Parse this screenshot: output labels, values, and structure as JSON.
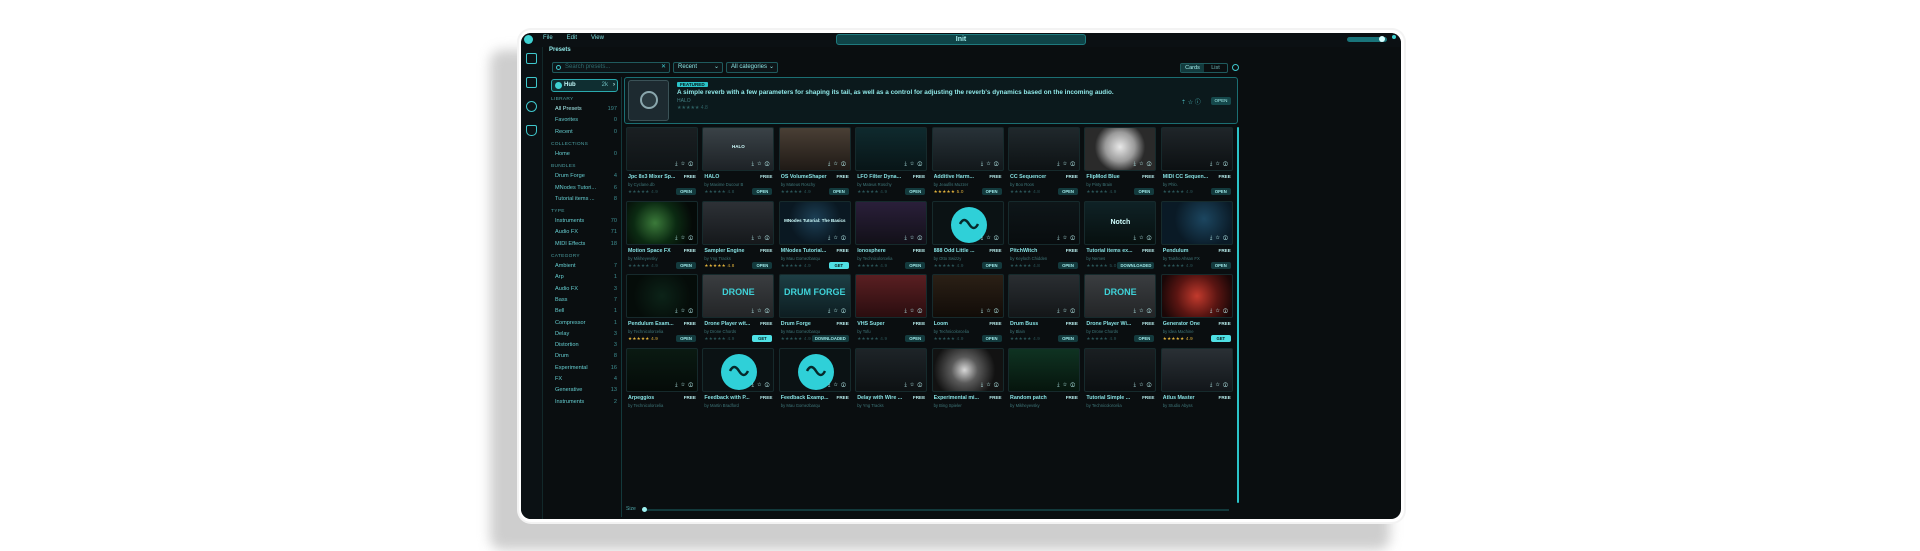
{
  "app": {
    "title": "Init",
    "menu": [
      "File",
      "Edit",
      "View"
    ]
  },
  "header": {
    "section_title": "Presets",
    "search_placeholder": "Search presets...",
    "sort_value": "Recent",
    "category_value": "All categories",
    "view_card": "Cards",
    "view_list": "List"
  },
  "sidebar": {
    "hub_label": "Hub",
    "hub_count": "2k",
    "sections": [
      {
        "title": "LIBRARY",
        "items": [
          {
            "label": "All Presets",
            "count": "197"
          },
          {
            "label": "Favorites",
            "count": "0"
          },
          {
            "label": "Recent",
            "count": "0"
          }
        ]
      },
      {
        "title": "COLLECTIONS",
        "items": [
          {
            "label": "Home",
            "count": "0"
          }
        ]
      },
      {
        "title": "BUNDLES",
        "items": [
          {
            "label": "Drum Forge",
            "count": "4"
          },
          {
            "label": "MNodes Tutori...",
            "count": "6"
          },
          {
            "label": "Tutorial items ...",
            "count": "8"
          }
        ]
      },
      {
        "title": "TYPE",
        "items": [
          {
            "label": "Instruments",
            "count": "70"
          },
          {
            "label": "Audio FX",
            "count": "71"
          },
          {
            "label": "MIDI Effects",
            "count": "18"
          }
        ]
      },
      {
        "title": "CATEGORY",
        "items": [
          {
            "label": "Ambient",
            "count": "7"
          },
          {
            "label": "Arp",
            "count": "1"
          },
          {
            "label": "Audio FX",
            "count": "3"
          },
          {
            "label": "Bass",
            "count": "7"
          },
          {
            "label": "Bell",
            "count": "1"
          },
          {
            "label": "Compressor",
            "count": "1"
          },
          {
            "label": "Delay",
            "count": "3"
          },
          {
            "label": "Distortion",
            "count": "3"
          },
          {
            "label": "Drum",
            "count": "8"
          },
          {
            "label": "Experimental",
            "count": "16"
          },
          {
            "label": "FX",
            "count": "4"
          },
          {
            "label": "Generative",
            "count": "13"
          },
          {
            "label": "Instruments",
            "count": "2"
          }
        ]
      }
    ]
  },
  "featured": {
    "tag": "FEATURED",
    "description": "A simple reverb with a few parameters for shaping its tail, as well as a control for adjusting the reverb's dynamics based on the incoming audio.",
    "name": "HALO",
    "rating": "★★★★★ 4.8",
    "open_label": "OPEN",
    "actions": "⇡ ☆ ⓘ"
  },
  "cards": [
    {
      "title": "Jpc 8x3 Mixer Sp...",
      "free": "FREE",
      "author": "by Cyclane.db",
      "stars": "★★★★★ 4.9",
      "button": "OPEN",
      "thumb_text": ""
    },
    {
      "title": "HALO",
      "free": "FREE",
      "author": "by Maxime Ducour B",
      "stars": "★★★★★ 4.8",
      "button": "OPEN",
      "thumb_text": "HALO"
    },
    {
      "title": "OS VolumeShaper",
      "free": "FREE",
      "author": "by Mateus Roschy",
      "stars": "★★★★★ 4.9",
      "button": "OPEN",
      "thumb_text": ""
    },
    {
      "title": "LFO Filter Dyna...",
      "free": "FREE",
      "author": "by Mateus Roschy",
      "stars": "★★★★★ 4.9",
      "button": "OPEN",
      "thumb_text": ""
    },
    {
      "title": "Additive Harm...",
      "free": "FREE",
      "author": "by Jeaufils Muzzer",
      "stars": "★★★★★ 5.0",
      "button": "OPEN",
      "thumb_text": "",
      "gold": true
    },
    {
      "title": "CC Sequencer",
      "free": "FREE",
      "author": "by Boo Roos",
      "stars": "★★★★★ 4.8",
      "button": "OPEN",
      "thumb_text": ""
    },
    {
      "title": "FlipMod Blue",
      "free": "FREE",
      "author": "by Pinty Brain",
      "stars": "★★★★★ 4.9",
      "button": "OPEN",
      "thumb_text": ""
    },
    {
      "title": "MIDI CC Sequen...",
      "free": "FREE",
      "author": "by Phlo.",
      "stars": "★★★★★ 4.9",
      "button": "OPEN",
      "thumb_text": ""
    },
    {
      "title": "Motion Space FX",
      "free": "FREE",
      "author": "by Mikheyevsky",
      "stars": "★★★★★ 4.9",
      "button": "OPEN",
      "thumb_text": ""
    },
    {
      "title": "Sampler Engine",
      "free": "FREE",
      "author": "by Yng Tracks",
      "stars": "★★★★★ 4.8",
      "button": "OPEN",
      "thumb_text": "",
      "gold": true
    },
    {
      "title": "MNodes Tutorial...",
      "free": "FREE",
      "author": "by Mau Gomezbarqu",
      "stars": "★★★★★ 4.9",
      "button": "GET",
      "thumb_text": "MNodes Tutorial: The Basics"
    },
    {
      "title": "Ionosphere",
      "free": "FREE",
      "author": "by Technicolorcelia",
      "stars": "★★★★★ 4.9",
      "button": "OPEN",
      "thumb_text": ""
    },
    {
      "title": "888 Odd Little ...",
      "free": "FREE",
      "author": "by Otto Swizzy",
      "stars": "★★★★★ 4.9",
      "button": "OPEN",
      "thumb_text": ""
    },
    {
      "title": "PitchWitch",
      "free": "FREE",
      "author": "by Keyloch Chidden",
      "stars": "★★★★★ 4.8",
      "button": "OPEN",
      "thumb_text": ""
    },
    {
      "title": "Tutorial items ex...",
      "free": "FREE",
      "author": "by Nemes",
      "stars": "★★★★★ 5.0",
      "button": "DOWNLOADED",
      "thumb_text": "Notch"
    },
    {
      "title": "Pendulum",
      "free": "FREE",
      "author": "by Taisho Ahsan FX",
      "stars": "★★★★★ 4.9",
      "button": "OPEN",
      "thumb_text": ""
    },
    {
      "title": "Pendulum Exam...",
      "free": "FREE",
      "author": "by Technicolorcelia",
      "stars": "★★★★★ 4.9",
      "button": "OPEN",
      "thumb_text": "",
      "gold": true
    },
    {
      "title": "Drone Player wit...",
      "free": "FREE",
      "author": "by Drone Chords",
      "stars": "★★★★★ 4.9",
      "button": "GET",
      "thumb_text": "DRONE"
    },
    {
      "title": "Drum Forge",
      "free": "FREE",
      "author": "by Mau Gomezbarqu",
      "stars": "★★★★★ 4.9",
      "button": "DOWNLOADED",
      "thumb_text": "DRUM FORGE"
    },
    {
      "title": "VHS Super",
      "free": "FREE",
      "author": "by Tofu",
      "stars": "★★★★★ 4.9",
      "button": "OPEN",
      "thumb_text": ""
    },
    {
      "title": "Loom",
      "free": "FREE",
      "author": "by Technicolorcelia",
      "stars": "★★★★★ 4.9",
      "button": "OPEN",
      "thumb_text": ""
    },
    {
      "title": "Drum Buss",
      "free": "FREE",
      "author": "by Blain",
      "stars": "★★★★★ 4.9",
      "button": "OPEN",
      "thumb_text": ""
    },
    {
      "title": "Drone Player Wi...",
      "free": "FREE",
      "author": "by Drone Chords",
      "stars": "★★★★★ 4.9",
      "button": "OPEN",
      "thumb_text": "DRONE"
    },
    {
      "title": "Generator One",
      "free": "FREE",
      "author": "by Idea Machine",
      "stars": "★★★★★ 4.9",
      "button": "GET",
      "thumb_text": "",
      "gold": true
    },
    {
      "title": "Arpeggios",
      "free": "FREE",
      "author": "by Technicolorcelia",
      "stars": "",
      "button": "",
      "thumb_text": ""
    },
    {
      "title": "Feedback with P...",
      "free": "FREE",
      "author": "by Martin Bradford",
      "stars": "",
      "button": "",
      "thumb_text": ""
    },
    {
      "title": "Feedback Examp...",
      "free": "FREE",
      "author": "by Mau Gomezbarqu",
      "stars": "",
      "button": "",
      "thumb_text": ""
    },
    {
      "title": "Delay with Wire ...",
      "free": "FREE",
      "author": "by Yng Tracks",
      "stars": "",
      "button": "",
      "thumb_text": ""
    },
    {
      "title": "Experimental mi...",
      "free": "FREE",
      "author": "by Bing Spieler",
      "stars": "",
      "button": "",
      "thumb_text": ""
    },
    {
      "title": "Random patch",
      "free": "FREE",
      "author": "by Mikheyevsky",
      "stars": "",
      "button": "",
      "thumb_text": ""
    },
    {
      "title": "Tutorial Simple ...",
      "free": "FREE",
      "author": "by Technicolorcelia",
      "stars": "",
      "button": "",
      "thumb_text": ""
    },
    {
      "title": "Atlus Master",
      "free": "FREE",
      "author": "by Studio Abyss",
      "stars": "",
      "button": "",
      "thumb_text": ""
    }
  ],
  "footer": {
    "size_label": "Size"
  }
}
